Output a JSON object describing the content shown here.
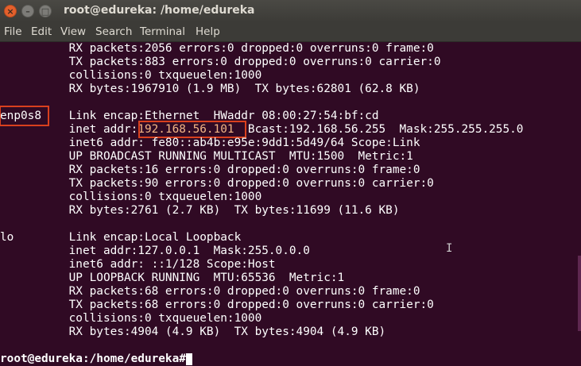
{
  "window": {
    "title": "root@edureka: /home/edureka",
    "close_glyph": "×",
    "min_glyph": "–",
    "max_glyph": "□"
  },
  "menu": [
    "File",
    "Edit",
    "View",
    "Search",
    "Terminal",
    "Help"
  ],
  "terminal": {
    "top_lines": [
      "          RX packets:2056 errors:0 dropped:0 overruns:0 frame:0",
      "          TX packets:883 errors:0 dropped:0 overruns:0 carrier:0",
      "          collisions:0 txqueuelen:1000",
      "          RX bytes:1967910 (1.9 MB)  TX bytes:62801 (62.8 KB)"
    ],
    "enp0s8": {
      "name": "enp0s8",
      "line1": "          Link encap:Ethernet  HWaddr 08:00:27:54:bf:cd",
      "inet_prefix": "          inet addr:",
      "ip": "192.168.56.101",
      "inet_suffix": "  Bcast:192.168.56.255  Mask:255.255.255.0",
      "rest": [
        "          inet6 addr: fe80::ab4b:e95e:9dd1:5d49/64 Scope:Link",
        "          UP BROADCAST RUNNING MULTICAST  MTU:1500  Metric:1",
        "          RX packets:16 errors:0 dropped:0 overruns:0 frame:0",
        "          TX packets:90 errors:0 dropped:0 overruns:0 carrier:0",
        "          collisions:0 txqueuelen:1000",
        "          RX bytes:2761 (2.7 KB)  TX bytes:11699 (11.6 KB)"
      ]
    },
    "lo": {
      "name": "lo",
      "lines": [
        "          Link encap:Local Loopback",
        "          inet addr:127.0.0.1  Mask:255.0.0.0",
        "          inet6 addr: ::1/128 Scope:Host",
        "          UP LOOPBACK RUNNING  MTU:65536  Metric:1",
        "          RX packets:68 errors:0 dropped:0 overruns:0 frame:0",
        "          TX packets:68 errors:0 dropped:0 overruns:0 carrier:0",
        "          collisions:0 txqueuelen:1000",
        "          RX bytes:4904 (4.9 KB)  TX bytes:4904 (4.9 KB)"
      ]
    },
    "prompt": "root@edureka:/home/edureka#",
    "ibeam_glyph": "I"
  }
}
